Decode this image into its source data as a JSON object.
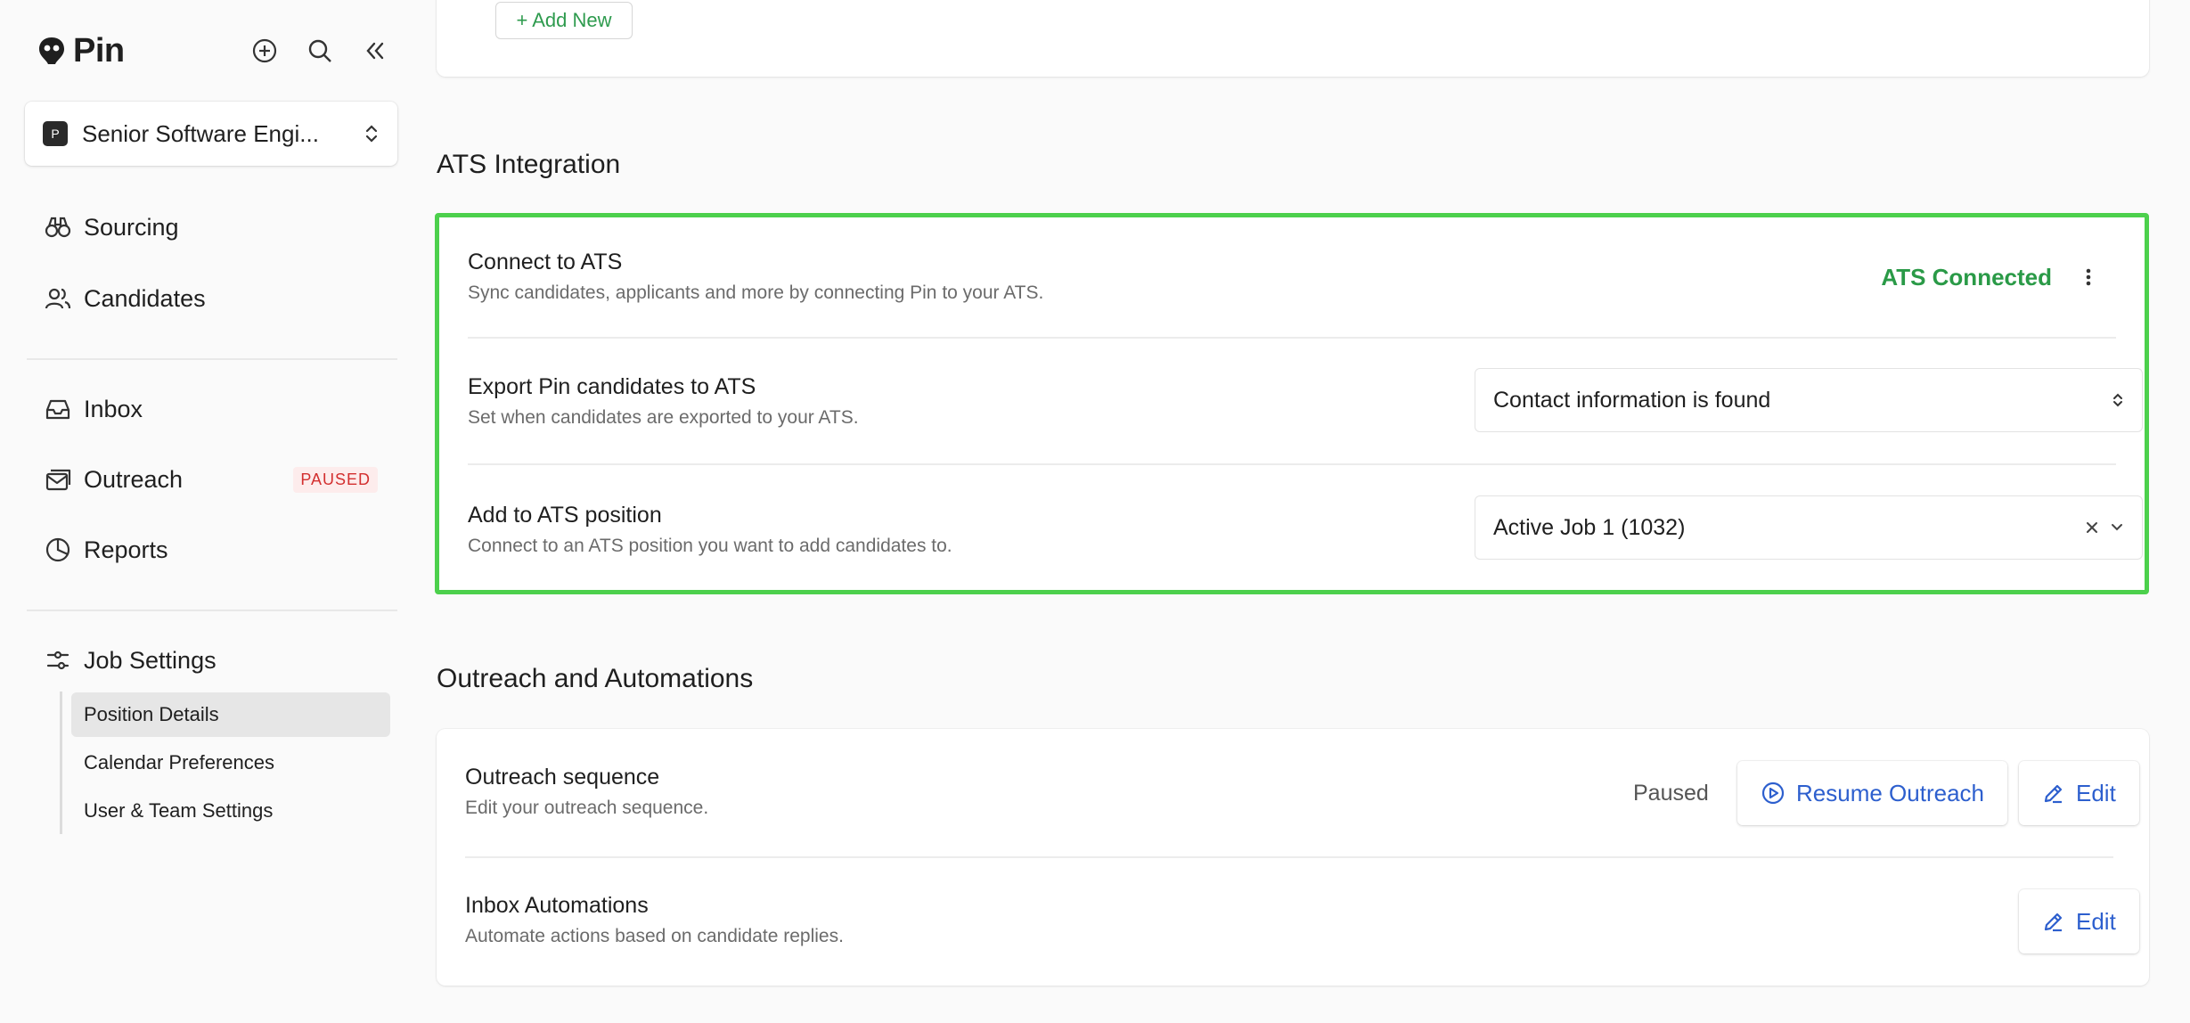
{
  "brand": {
    "name": "Pin"
  },
  "job_selector": {
    "avatar_letter": "P",
    "name": "Senior Software Engi..."
  },
  "nav": {
    "sourcing": "Sourcing",
    "candidates": "Candidates",
    "inbox": "Inbox",
    "outreach": "Outreach",
    "outreach_badge": "PAUSED",
    "reports": "Reports",
    "job_settings": "Job Settings"
  },
  "job_settings_sub": {
    "position_details": "Position Details",
    "calendar_preferences": "Calendar Preferences",
    "user_team_settings": "User & Team Settings"
  },
  "top_card": {
    "add_new": "+ Add New"
  },
  "ats": {
    "section_title": "ATS Integration",
    "connect": {
      "title": "Connect to ATS",
      "desc": "Sync candidates, applicants and more by connecting Pin to your ATS.",
      "status": "ATS Connected"
    },
    "export": {
      "title": "Export Pin candidates to ATS",
      "desc": "Set when candidates are exported to your ATS.",
      "value": "Contact information is found"
    },
    "position": {
      "title": "Add to ATS position",
      "desc": "Connect to an ATS position you want to add candidates to.",
      "value": "Active Job 1 (1032)"
    }
  },
  "outreach": {
    "section_title": "Outreach and Automations",
    "sequence": {
      "title": "Outreach sequence",
      "desc": "Edit your outreach sequence.",
      "status": "Paused",
      "resume_label": "Resume Outreach",
      "edit_label": "Edit"
    },
    "inbox_auto": {
      "title": "Inbox Automations",
      "desc": "Automate actions based on candidate replies.",
      "edit_label": "Edit"
    }
  },
  "colors": {
    "accent_green": "#2a9a47",
    "highlight_border": "#4cd04c",
    "link_blue": "#2d5fce",
    "paused_red": "#d32f2f"
  }
}
